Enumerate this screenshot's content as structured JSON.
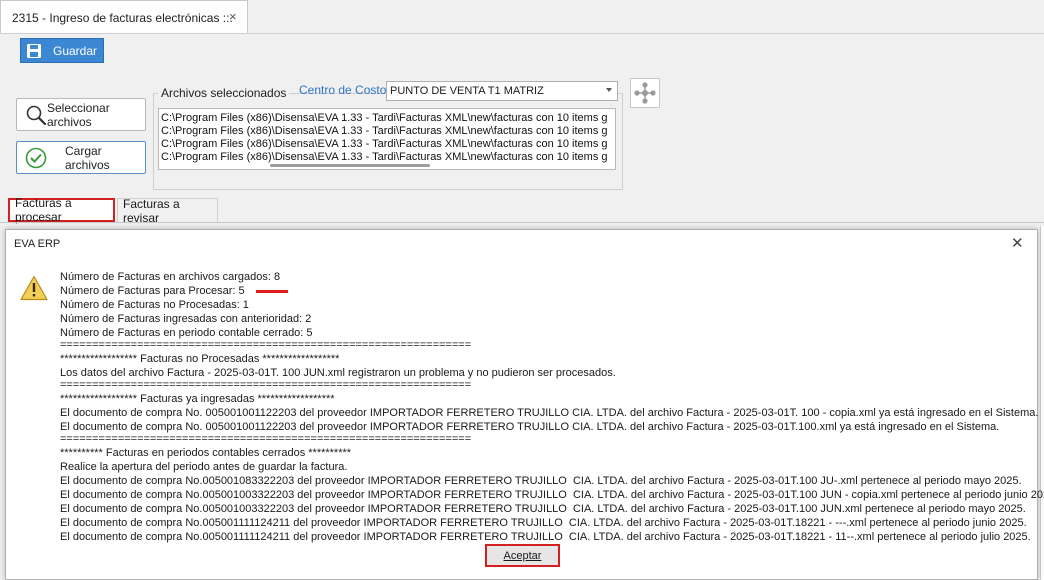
{
  "doc_tab": {
    "title": "2315 - Ingreso de facturas electrónicas ::.",
    "close": "×"
  },
  "toolbar": {
    "save_label": "Guardar"
  },
  "side_buttons": {
    "select_label": "Seleccionar archivos",
    "load_label": "Cargar archivos"
  },
  "files_group": {
    "label": "Archivos seleccionados",
    "cost_center_label": "Centro de Costo:",
    "cost_center_value": "PUNTO DE VENTA T1 MATRIZ",
    "files": [
      "C:\\Program Files (x86)\\Disensa\\EVA 1.33 - Tardi\\Facturas XML\\new\\facturas con 10 items g",
      "C:\\Program Files (x86)\\Disensa\\EVA 1.33 - Tardi\\Facturas XML\\new\\facturas con 10 items g",
      "C:\\Program Files (x86)\\Disensa\\EVA 1.33 - Tardi\\Facturas XML\\new\\facturas con 10 items g",
      "C:\\Program Files (x86)\\Disensa\\EVA 1.33 - Tardi\\Facturas XML\\new\\facturas con 10 items g"
    ]
  },
  "tabs": [
    {
      "label": "Facturas a procesar"
    },
    {
      "label": "Facturas a revisar"
    }
  ],
  "dialog": {
    "title": "EVA ERP",
    "close": "✕",
    "ok_label": "Aceptar",
    "lines": [
      "Número de Facturas en archivos cargados: 8",
      "Número de Facturas para Procesar: 5",
      "Número de Facturas no Procesadas: 1",
      "Número de Facturas ingresadas con anterioridad: 2",
      "Número de Facturas en periodo contable cerrado: 5",
      "================================================================",
      "****************** Facturas no Procesadas ******************",
      "Los datos del archivo Factura - 2025-03-01T. 100 JUN.xml registraron un problema y no pudieron ser procesados.",
      "================================================================",
      "****************** Facturas ya ingresadas ******************",
      "El documento de compra No. 005001001122203 del proveedor IMPORTADOR FERRETERO TRUJILLO CIA. LTDA. del archivo Factura - 2025-03-01T. 100 - copia.xml ya está ingresado en el Sistema.",
      "El documento de compra No. 005001001122203 del proveedor IMPORTADOR FERRETERO TRUJILLO CIA. LTDA. del archivo Factura - 2025-03-01T.100.xml ya está ingresado en el Sistema.",
      "================================================================",
      "********** Facturas en periodos contables cerrados **********",
      "Realice la apertura del periodo antes de guardar la factura.",
      "El documento de compra No.005001083322203 del proveedor IMPORTADOR FERRETERO TRUJILLO  CIA. LTDA. del archivo Factura - 2025-03-01T.100 JU-.xml pertenece al periodo mayo 2025.",
      "El documento de compra No.005001003322203 del proveedor IMPORTADOR FERRETERO TRUJILLO  CIA. LTDA. del archivo Factura - 2025-03-01T.100 JUN - copia.xml pertenece al periodo junio 2025.",
      "El documento de compra No.005001003322203 del proveedor IMPORTADOR FERRETERO TRUJILLO  CIA. LTDA. del archivo Factura - 2025-03-01T.100 JUN.xml pertenece al periodo mayo 2025.",
      "El documento de compra No.005001111124211 del proveedor IMPORTADOR FERRETERO TRUJILLO  CIA. LTDA. del archivo Factura - 2025-03-01T.18221 - ---.xml pertenece al periodo junio 2025.",
      "El documento de compra No.005001111124211 del proveedor IMPORTADOR FERRETERO TRUJILLO  CIA. LTDA. del archivo Factura - 2025-03-01T.18221 - 11--.xml pertenece al periodo julio 2025."
    ]
  },
  "colors": {
    "accent": "#3c87d4",
    "highlight": "#d42020",
    "link": "#2d74c4"
  }
}
